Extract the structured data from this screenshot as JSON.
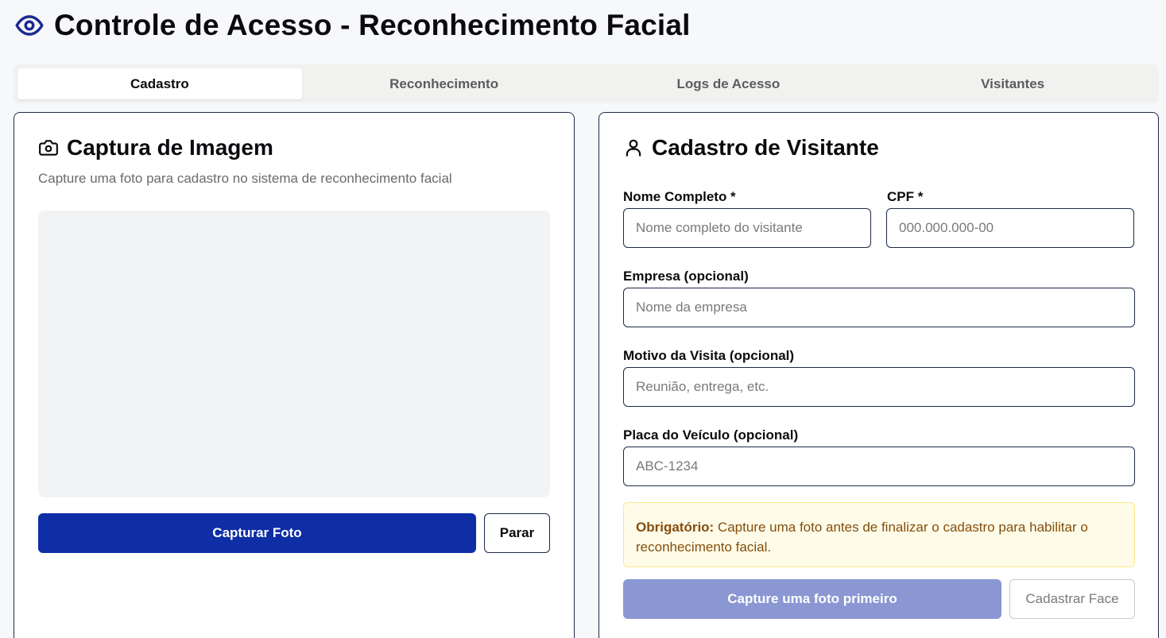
{
  "header": {
    "title": "Controle de Acesso - Reconhecimento Facial",
    "icon": "eye-icon",
    "accent": "#1b2a8f"
  },
  "tabs": [
    {
      "label": "Cadastro",
      "active": true
    },
    {
      "label": "Reconhecimento",
      "active": false
    },
    {
      "label": "Logs de Acesso",
      "active": false
    },
    {
      "label": "Visitantes",
      "active": false
    }
  ],
  "capture": {
    "title": "Captura de Imagem",
    "icon": "camera-icon",
    "subtitle": "Capture uma foto para cadastro no sistema de reconhecimento facial",
    "capture_button": "Capturar Foto",
    "stop_button": "Parar"
  },
  "form": {
    "title": "Cadastro de Visitante",
    "icon": "user-icon",
    "name_label": "Nome Completo *",
    "name_placeholder": "Nome completo do visitante",
    "cpf_label": "CPF *",
    "cpf_placeholder": "000.000.000-00",
    "company_label": "Empresa (opcional)",
    "company_placeholder": "Nome da empresa",
    "reason_label": "Motivo da Visita (opcional)",
    "reason_placeholder": "Reunião, entrega, etc.",
    "plate_label": "Placa do Veículo (opcional)",
    "plate_placeholder": "ABC-1234",
    "notice_bold": "Obrigatório:",
    "notice_text": " Capture uma foto antes de finalizar o cadastro para habilitar o reconhecimento facial.",
    "submit_button": "Capture uma foto primeiro",
    "face_button": "Cadastrar Face"
  },
  "colors": {
    "primary": "#0f2ea6",
    "primary_disabled": "#8a97d3",
    "notice_bg": "#fefce8",
    "notice_text": "#854d0e"
  }
}
